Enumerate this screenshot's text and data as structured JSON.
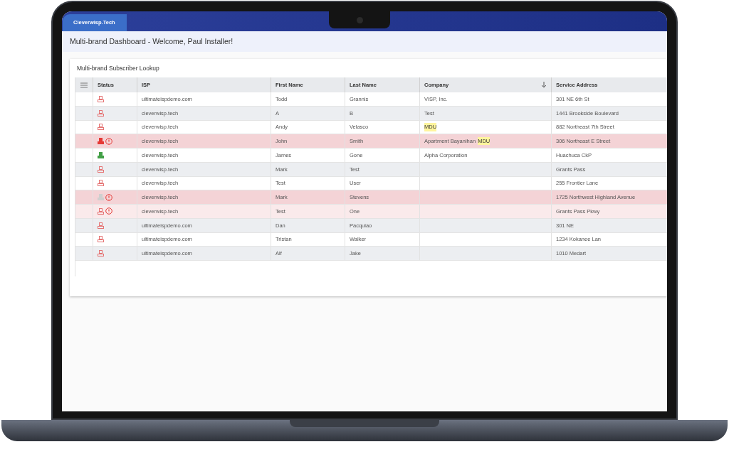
{
  "app_tab": "Cleverwisp.Tech",
  "page_title": "Multi-brand Dashboard - Welcome, Paul Installer!",
  "card_title": "Multi-brand Subscriber Lookup",
  "columns": [
    {
      "label": "Status",
      "sorted": false
    },
    {
      "label": "ISP",
      "sorted": false
    },
    {
      "label": "First Name",
      "sorted": false
    },
    {
      "label": "Last Name",
      "sorted": false
    },
    {
      "label": "Company",
      "sorted": true
    },
    {
      "label": "Service Address",
      "sorted": false
    }
  ],
  "rows": [
    {
      "filled": false,
      "color": "#e57373",
      "alert": false,
      "error": false,
      "warning": false,
      "isp": "ultimateispdemo.com",
      "first": "Todd",
      "last": "Grannis",
      "company": "VISP, Inc.",
      "company_tag": "",
      "address": "301 NE 6th St"
    },
    {
      "filled": false,
      "color": "#e57373",
      "alert": false,
      "error": false,
      "warning": false,
      "isp": "cleverwisp.tech",
      "first": "A",
      "last": "B",
      "company": "Test",
      "company_tag": "",
      "address": "1441 Brookside Boulevard"
    },
    {
      "filled": false,
      "color": "#e57373",
      "alert": false,
      "error": false,
      "warning": false,
      "isp": "cleverwisp.tech",
      "first": "Andy",
      "last": "Velasco",
      "company": "",
      "company_tag": "MDU",
      "address": "882 Northeast 7th Street"
    },
    {
      "filled": true,
      "color": "#e53935",
      "alert": true,
      "error": true,
      "warning": false,
      "isp": "cleverwisp.tech",
      "first": "John",
      "last": "Smith",
      "company": "Apartment Bayanihan",
      "company_tag": "MDU",
      "address": "306 Northeast E Street"
    },
    {
      "filled": true,
      "color": "#43a047",
      "alert": false,
      "error": false,
      "warning": false,
      "isp": "cleverwisp.tech",
      "first": "James",
      "last": "Gone",
      "company": "Alpha Corporation",
      "company_tag": "",
      "address": "Huachuca CkP"
    },
    {
      "filled": false,
      "color": "#e57373",
      "alert": false,
      "error": false,
      "warning": false,
      "isp": "cleverwisp.tech",
      "first": "Mark",
      "last": "Test",
      "company": "",
      "company_tag": "",
      "address": "Grants Pass"
    },
    {
      "filled": false,
      "color": "#e57373",
      "alert": false,
      "error": false,
      "warning": false,
      "isp": "cleverwisp.tech",
      "first": "Test",
      "last": "User",
      "company": "",
      "company_tag": "",
      "address": "255 Frontier Lane"
    },
    {
      "filled": true,
      "color": "#cfcfcf",
      "alert": true,
      "error": true,
      "warning": false,
      "isp": "cleverwisp.tech",
      "first": "Mark",
      "last": "Stevens",
      "company": "",
      "company_tag": "",
      "address": "1725 Northwest Highland Avenue"
    },
    {
      "filled": false,
      "color": "#e57373",
      "alert": true,
      "error": false,
      "warning": true,
      "isp": "cleverwisp.tech",
      "first": "Test",
      "last": "One",
      "company": "",
      "company_tag": "",
      "address": "Grants Pass Pkwy"
    },
    {
      "filled": false,
      "color": "#e57373",
      "alert": false,
      "error": false,
      "warning": false,
      "isp": "ultimateispdemo.com",
      "first": "Dan",
      "last": "Pacquiao",
      "company": "",
      "company_tag": "",
      "address": "301 NE"
    },
    {
      "filled": false,
      "color": "#e57373",
      "alert": false,
      "error": false,
      "warning": false,
      "isp": "ultimateispdemo.com",
      "first": "Tristan",
      "last": "Walker",
      "company": "",
      "company_tag": "",
      "address": "1234 Kokanee Lan"
    },
    {
      "filled": false,
      "color": "#e57373",
      "alert": false,
      "error": false,
      "warning": false,
      "isp": "ultimateispdemo.com",
      "first": "Alf",
      "last": "Jake",
      "company": "",
      "company_tag": "",
      "address": "1010 Medart"
    }
  ]
}
